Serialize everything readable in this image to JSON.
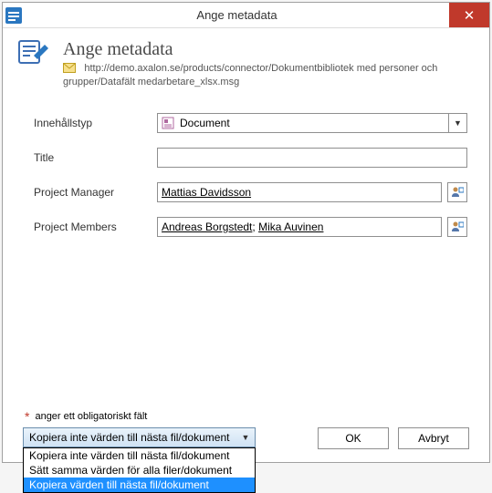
{
  "window": {
    "title": "Ange metadata"
  },
  "header": {
    "title": "Ange metadata",
    "url": "http://demo.axalon.se/products/connector/Dokumentbibliotek med personer och grupper/Datafält medarbetare_xlsx.msg"
  },
  "form": {
    "content_type": {
      "label": "Innehållstyp",
      "value": "Document"
    },
    "title": {
      "label": "Title",
      "value": ""
    },
    "project_manager": {
      "label": "Project Manager",
      "value": "Mattias Davidsson"
    },
    "project_members": {
      "label": "Project Members",
      "values": [
        "Andreas Borgstedt",
        "Mika Auvinen"
      ],
      "value_text": "Andreas Borgstedt; Mika Auvinen"
    }
  },
  "footer": {
    "required_note": "anger ett obligatoriskt fält",
    "copy_dropdown": {
      "selected": "Kopiera inte värden till nästa fil/dokument",
      "options": [
        "Kopiera inte värden till nästa fil/dokument",
        "Sätt samma värden för alla filer/dokument",
        "Kopiera värden till nästa fil/dokument"
      ],
      "highlighted": "Kopiera värden till nästa fil/dokument"
    },
    "ok_label": "OK",
    "cancel_label": "Avbryt"
  }
}
